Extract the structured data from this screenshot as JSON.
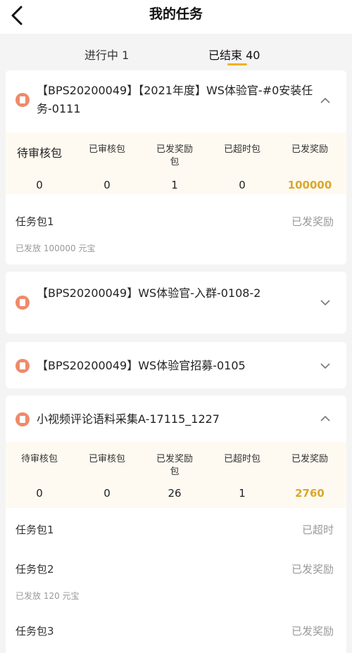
{
  "header": {
    "title": "我的任务"
  },
  "tabs": [
    {
      "label": "进行中 1"
    },
    {
      "label": "已结束 40"
    }
  ],
  "stat_labels": [
    "待审核包",
    "已审核包",
    "已发奖励包",
    "已超时包",
    "已发奖励"
  ],
  "tasks": [
    {
      "title": "【BPS20200049】【2021年度】WS体验官-#0安装任务-0111",
      "stats": [
        "0",
        "0",
        "1",
        "0",
        "100000"
      ],
      "packages": [
        {
          "name": "任务包1",
          "status": "已发奖励",
          "sub": "已发放 100000 元宝"
        }
      ]
    },
    {
      "title": "【BPS20200049】WS体验官-入群-0108-2"
    },
    {
      "title": "【BPS20200049】WS体验官招募-0105"
    },
    {
      "title": "小视频评论语料采集A-17115_1227",
      "stats": [
        "0",
        "0",
        "26",
        "1",
        "2760"
      ],
      "packages": [
        {
          "name": "任务包1",
          "status": "已超时"
        },
        {
          "name": "任务包2",
          "status": "已发奖励",
          "sub": "已发放 120 元宝"
        },
        {
          "name": "任务包3",
          "status": "已发奖励"
        }
      ]
    }
  ],
  "colors": {
    "accent": "#f2b21f",
    "gold_value": "#d9a82b",
    "task_icon": "#ef8a6a",
    "stats_bg": "#fffaf1"
  }
}
